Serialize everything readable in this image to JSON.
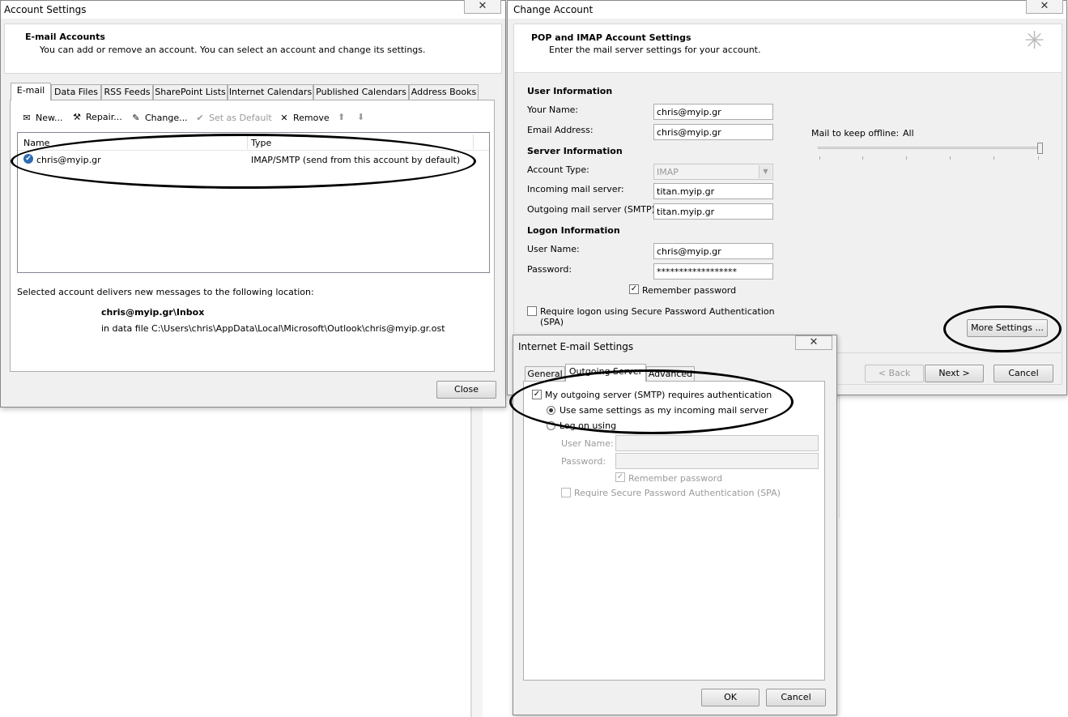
{
  "account_settings": {
    "title": "Account Settings",
    "close_glyph": "✕",
    "heading": "E-mail Accounts",
    "description": "You can add or remove an account. You can select an account and change its settings.",
    "tabs": [
      "E-mail",
      "Data Files",
      "RSS Feeds",
      "SharePoint Lists",
      "Internet Calendars",
      "Published Calendars",
      "Address Books"
    ],
    "toolbar": {
      "new": "New...",
      "repair": "Repair...",
      "change": "Change...",
      "set_default": "Set as Default",
      "remove": "Remove"
    },
    "columns": {
      "name": "Name",
      "type": "Type"
    },
    "rows": [
      {
        "name": "chris@myip.gr",
        "type": "IMAP/SMTP (send from this account by default)"
      }
    ],
    "delivery_label": "Selected account delivers new messages to the following location:",
    "delivery_folder": "chris@myip.gr\\Inbox",
    "delivery_file": "in data file C:\\Users\\chris\\AppData\\Local\\Microsoft\\Outlook\\chris@myip.gr.ost",
    "close_button": "Close"
  },
  "change_account": {
    "title": "Change Account",
    "close_glyph": "✕",
    "heading": "POP and IMAP Account Settings",
    "subheading": "Enter the mail server settings for your account.",
    "user_info": "User Information",
    "your_name_label": "Your Name:",
    "your_name": "chris@myip.gr",
    "email_label": "Email Address:",
    "email": "chris@myip.gr",
    "server_info": "Server Information",
    "account_type_label": "Account Type:",
    "account_type": "IMAP",
    "incoming_label": "Incoming mail server:",
    "incoming": "titan.myip.gr",
    "outgoing_label": "Outgoing mail server (SMTP):",
    "outgoing": "titan.myip.gr",
    "logon_info": "Logon Information",
    "username_label": "User Name:",
    "username": "chris@myip.gr",
    "password_label": "Password:",
    "password": "******************",
    "remember_password": "Remember password",
    "spa_line1": "Require logon using Secure Password Authentication",
    "spa_line2": "(SPA)",
    "offline_label": "Mail to keep offline:",
    "offline_value": "All",
    "offline_level": 1.0,
    "more_settings": "More Settings ...",
    "back": "< Back",
    "next": "Next >",
    "cancel": "Cancel"
  },
  "internet_email": {
    "title": "Internet E-mail Settings",
    "close_glyph": "✕",
    "tabs": [
      "General",
      "Outgoing Server",
      "Advanced"
    ],
    "smtp_auth": "My outgoing server (SMTP) requires authentication",
    "use_same": "Use same settings as my incoming mail server",
    "log_on_using": "Log on using",
    "username_label": "User Name:",
    "password_label": "Password:",
    "remember_password": "Remember password",
    "require_spa": "Require Secure Password Authentication (SPA)",
    "ok": "OK",
    "cancel": "Cancel"
  }
}
